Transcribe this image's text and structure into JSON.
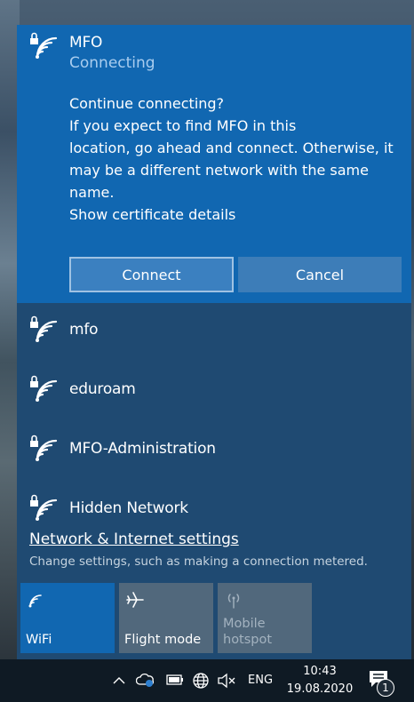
{
  "active_network": {
    "name": "MFO",
    "status": "Connecting",
    "message_lines": [
      "Continue connecting?",
      "If you expect to find MFO in this",
      "location, go ahead and connect. Otherwise, it",
      "may be a different network with the same",
      "name.",
      "Show certificate details"
    ],
    "connect_label": "Connect",
    "cancel_label": "Cancel"
  },
  "networks": [
    {
      "name": "mfo",
      "icon": "wifi-secured-icon"
    },
    {
      "name": "eduroam",
      "icon": "wifi-secured-icon"
    },
    {
      "name": "MFO-Administration",
      "icon": "wifi-secured-icon"
    },
    {
      "name": "Hidden Network",
      "icon": "wifi-secured-icon"
    }
  ],
  "settings": {
    "link": "Network & Internet settings",
    "description": "Change settings, such as making a connection metered."
  },
  "quick_actions": [
    {
      "label": "WiFi",
      "state": "on",
      "icon": "wifi-icon"
    },
    {
      "label": "Flight mode",
      "state": "off",
      "icon": "airplane-icon"
    },
    {
      "label": "Mobile\nhotspot",
      "state": "disabled",
      "icon": "hotspot-icon"
    }
  ],
  "taskbar": {
    "language": "ENG",
    "time": "10:43",
    "date": "19.08.2020",
    "notification_count": "1"
  },
  "colors": {
    "accent": "#1167b1",
    "panel": "#1f4a72",
    "taskbar": "#0f1a24"
  }
}
